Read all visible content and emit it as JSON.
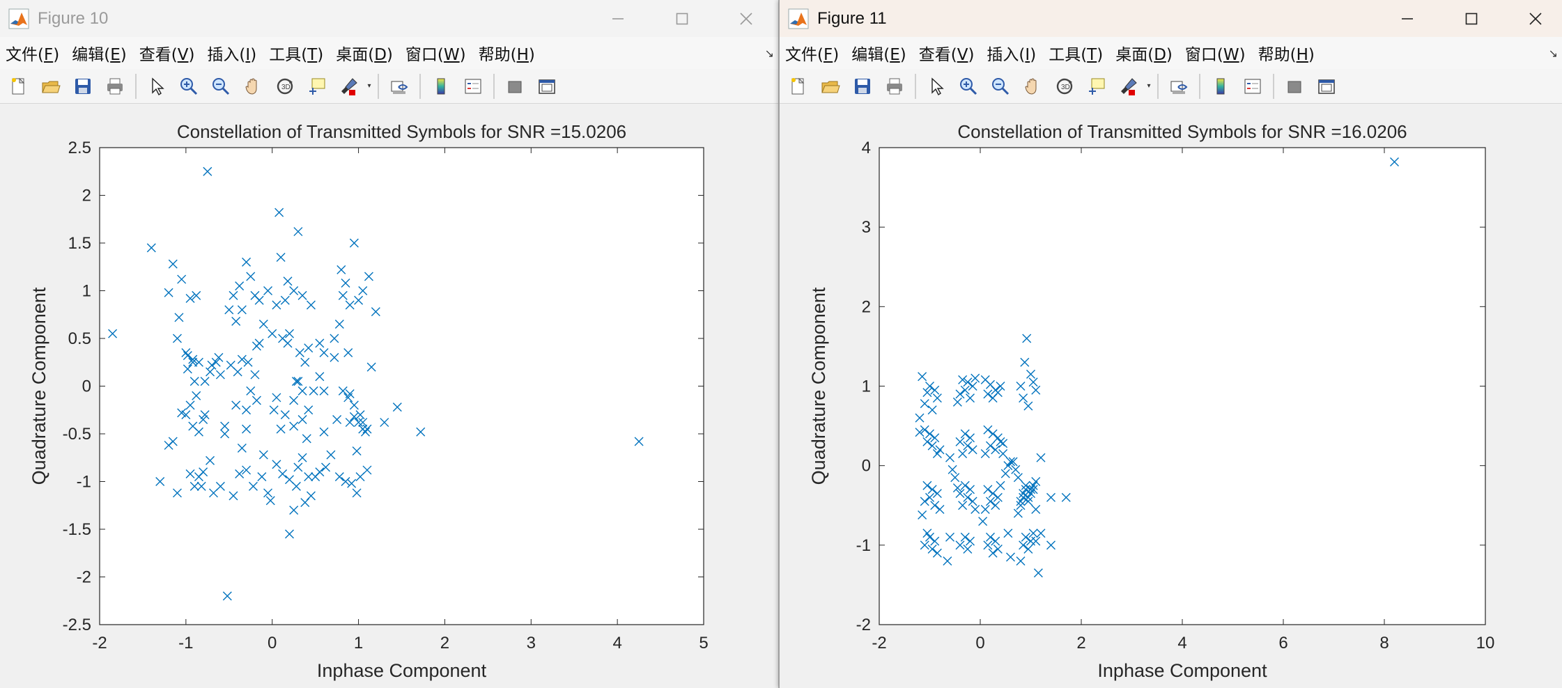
{
  "menu": [
    {
      "label": "文件(",
      "key": "F",
      "tail": ")"
    },
    {
      "label": "编辑(",
      "key": "E",
      "tail": ")"
    },
    {
      "label": "查看(",
      "key": "V",
      "tail": ")"
    },
    {
      "label": "插入(",
      "key": "I",
      "tail": ")"
    },
    {
      "label": "工具(",
      "key": "T",
      "tail": ")"
    },
    {
      "label": "桌面(",
      "key": "D",
      "tail": ")"
    },
    {
      "label": "窗口(",
      "key": "W",
      "tail": ")"
    },
    {
      "label": "帮助(",
      "key": "H",
      "tail": ")"
    }
  ],
  "toolbar_icons": [
    "new-figure-icon",
    "open-file-icon",
    "save-icon",
    "print-icon",
    "|",
    "pointer-icon",
    "zoom-in-icon",
    "zoom-out-icon",
    "pan-hand-icon",
    "rotate-3d-icon",
    "data-cursor-icon",
    "brush-icon",
    "v",
    "|",
    "link-plot-icon",
    "|",
    "colorbar-icon",
    "legend-icon",
    "|",
    "hide-plot-tools-icon",
    "show-plot-tools-icon"
  ],
  "colors": {
    "marker": "#0072BD",
    "axes_text": "#262626",
    "matlab_orange": "#e8731c"
  },
  "windows": [
    {
      "title": "Figure 10",
      "chart_data": {
        "type": "scatter",
        "marker": "x",
        "title": "Constellation of Transmitted Symbols for SNR =15.0206",
        "xlabel": "Inphase Component",
        "ylabel": "Quadrature Component",
        "xlim": [
          -2,
          5
        ],
        "ylim": [
          -2.5,
          2.5
        ],
        "xticks": [
          -2,
          -1,
          0,
          1,
          2,
          3,
          4,
          5
        ],
        "yticks": [
          -2.5,
          -2,
          -1.5,
          -1,
          -0.5,
          0,
          0.5,
          1,
          1.5,
          2,
          2.5
        ],
        "xtick_labels": [
          "-2",
          "-1",
          "0",
          "1",
          "2",
          "3",
          "4",
          "5"
        ],
        "ytick_labels": [
          "-2.5",
          "-2",
          "-1.5",
          "-1",
          "-0.5",
          "0",
          "0.5",
          "1",
          "1.5",
          "2",
          "2.5"
        ],
        "x": [
          -1.85,
          -1.4,
          -0.75,
          0.08,
          0.3,
          -1.2,
          -1.15,
          -1.05,
          -0.95,
          -0.88,
          -1.08,
          -0.3,
          -0.25,
          -0.45,
          -0.38,
          -0.5,
          0.1,
          0.18,
          0.25,
          0.35,
          0.45,
          0.15,
          0.05,
          -0.15,
          -0.05,
          -0.2,
          -0.35,
          -0.42,
          0.8,
          0.85,
          0.95,
          1.0,
          1.05,
          1.12,
          0.9,
          0.82,
          0.78,
          1.2,
          0.72,
          0.2,
          0.32,
          0.42,
          0.55,
          0.38,
          -1.1,
          -1.0,
          -0.92,
          -0.85,
          -0.98,
          -0.7,
          -0.78,
          -0.65,
          -0.88,
          -0.95,
          -1.05,
          -0.15,
          -0.4,
          -0.28,
          0.28,
          0.48,
          0.25,
          0.6,
          0.35,
          0.15,
          -0.55,
          0.82,
          0.88,
          0.95,
          1.02,
          0.75,
          1.05,
          1.1,
          1.3,
          1.45,
          1.72,
          4.25,
          -1.3,
          -1.1,
          -0.9,
          -0.95,
          -0.82,
          -0.72,
          -0.68,
          -0.85,
          -0.6,
          -0.45,
          -0.38,
          -0.3,
          -0.22,
          -0.12,
          -0.05,
          0.05,
          0.12,
          0.2,
          0.28,
          0.35,
          0.42,
          0.55,
          0.62,
          0.78,
          0.85,
          0.92,
          0.98,
          1.02,
          1.1,
          -1.15,
          -0.92,
          -0.8,
          -0.55,
          -0.3,
          -0.18,
          0.02,
          0.1,
          0.25,
          0.4,
          0.6,
          0.9,
          0.95,
          1.05,
          0.2,
          0.25,
          -0.52,
          0.38,
          0.45,
          -0.02,
          -0.1,
          -0.35,
          -0.85,
          -1.0,
          -0.78,
          0.3,
          0.68,
          0.5,
          0.88,
          1.15,
          -0.62,
          -0.2,
          0.0,
          -0.9,
          0.05,
          0.35,
          -0.72,
          -0.3,
          1.0,
          -0.48,
          -0.98,
          -0.35,
          0.6,
          -0.25,
          -0.1,
          0.72,
          0.9,
          -1.2,
          0.12,
          -0.6,
          0.42,
          -0.92,
          0.18,
          0.55,
          1.08,
          -0.42,
          -0.18,
          0.3,
          0.98,
          -0.8,
          -1.05
        ],
        "y": [
          0.55,
          1.45,
          2.25,
          1.82,
          1.62,
          0.98,
          1.28,
          1.12,
          0.92,
          0.95,
          0.72,
          1.3,
          1.15,
          0.95,
          1.05,
          0.8,
          1.35,
          1.1,
          1.0,
          0.95,
          0.85,
          0.9,
          0.85,
          0.9,
          1.0,
          0.95,
          0.8,
          0.68,
          1.22,
          1.08,
          1.5,
          0.9,
          1.0,
          1.15,
          0.85,
          0.95,
          0.65,
          0.78,
          0.5,
          0.55,
          0.35,
          0.4,
          0.45,
          0.25,
          0.5,
          0.35,
          0.28,
          0.25,
          0.18,
          0.22,
          0.05,
          0.25,
          -0.1,
          -0.2,
          -0.28,
          0.45,
          0.15,
          0.25,
          0.05,
          -0.05,
          -0.15,
          -0.05,
          -0.35,
          -0.3,
          -0.42,
          -0.05,
          -0.12,
          -0.2,
          -0.3,
          -0.35,
          -0.38,
          -0.45,
          -0.38,
          -0.22,
          -0.48,
          -0.58,
          -1.0,
          -1.12,
          -1.05,
          -0.92,
          -1.05,
          -0.78,
          -1.12,
          -0.95,
          -1.05,
          -1.15,
          -0.92,
          -0.88,
          -1.05,
          -0.95,
          -1.12,
          -0.82,
          -0.92,
          -0.98,
          -1.05,
          -0.75,
          -0.95,
          -0.9,
          -0.85,
          -0.95,
          -1.0,
          -1.02,
          -1.12,
          -0.95,
          -0.88,
          -0.58,
          -0.42,
          -0.35,
          -0.5,
          -0.45,
          -0.15,
          -0.25,
          -0.45,
          -0.42,
          -0.55,
          -0.48,
          -0.38,
          -0.32,
          -0.45,
          -1.55,
          -1.3,
          -2.2,
          -1.22,
          -1.15,
          -1.2,
          -0.72,
          -0.65,
          -0.48,
          -0.3,
          -0.3,
          -0.85,
          -0.72,
          -0.95,
          0.35,
          0.2,
          0.3,
          0.12,
          0.55,
          0.05,
          -0.12,
          -0.05,
          0.15,
          -0.25,
          -0.38,
          0.22,
          0.32,
          0.28,
          0.35,
          -0.05,
          0.65,
          0.3,
          -0.08,
          -0.62,
          0.5,
          0.12,
          -0.25,
          0.25,
          0.45,
          0.1,
          -0.48,
          -0.2,
          0.42,
          0.05,
          -0.68,
          -0.9
        ]
      }
    },
    {
      "title": "Figure 11",
      "chart_data": {
        "type": "scatter",
        "marker": "x",
        "title": "Constellation of Transmitted Symbols for SNR =16.0206",
        "xlabel": "Inphase Component",
        "ylabel": "Quadrature Component",
        "xlim": [
          -2,
          10
        ],
        "ylim": [
          -2,
          4
        ],
        "xticks": [
          -2,
          0,
          2,
          4,
          6,
          8,
          10
        ],
        "yticks": [
          -2,
          -1,
          0,
          1,
          2,
          3,
          4
        ],
        "xtick_labels": [
          "-2",
          "0",
          "2",
          "4",
          "6",
          "8",
          "10"
        ],
        "ytick_labels": [
          "-2",
          "-1",
          "0",
          "1",
          "2",
          "3",
          "4"
        ],
        "x": [
          8.2,
          0.92,
          0.88,
          1.0,
          1.05,
          0.8,
          1.1,
          0.85,
          0.95,
          -1.15,
          -1.0,
          -0.9,
          -1.05,
          -0.85,
          -1.1,
          -0.95,
          -1.2,
          -0.35,
          -0.25,
          -0.15,
          -0.3,
          -0.4,
          -0.2,
          -0.1,
          -0.45,
          0.1,
          0.2,
          0.3,
          0.35,
          0.15,
          0.25,
          0.4,
          -1.1,
          -1.0,
          -0.9,
          -1.05,
          -0.95,
          -0.8,
          -1.2,
          -0.85,
          -0.3,
          -0.2,
          -0.4,
          -0.25,
          -0.15,
          -0.35,
          0.15,
          0.25,
          0.35,
          0.4,
          0.2,
          0.3,
          0.1,
          0.45,
          0.9,
          1.0,
          0.85,
          0.95,
          0.8,
          1.05,
          1.1,
          0.75,
          1.4,
          1.2,
          1.7,
          -1.05,
          -0.95,
          -0.85,
          -1.0,
          -1.1,
          -0.9,
          -0.8,
          -1.15,
          -0.3,
          -0.2,
          -0.4,
          -0.25,
          -0.15,
          -0.35,
          -0.1,
          -0.45,
          0.15,
          0.25,
          0.35,
          0.2,
          0.3,
          0.1,
          0.4,
          0.9,
          1.0,
          0.85,
          0.95,
          0.8,
          1.1,
          1.05,
          0.75,
          1.4,
          1.2,
          1.15,
          -1.0,
          -0.9,
          -1.1,
          -0.95,
          -0.85,
          -1.05,
          -0.3,
          -0.2,
          -0.4,
          -0.25,
          0.2,
          0.3,
          0.15,
          0.35,
          0.25,
          0.9,
          1.0,
          0.85,
          0.95,
          1.05,
          1.1,
          0.8,
          0.05,
          0.6,
          0.55,
          0.5,
          -0.55,
          -0.6,
          0.65,
          0.7,
          -0.5,
          0.45,
          -0.6,
          0.55,
          -0.65,
          0.6
        ],
        "y": [
          3.82,
          1.6,
          1.3,
          1.15,
          1.05,
          1.0,
          0.95,
          0.85,
          0.75,
          1.12,
          1.0,
          0.95,
          0.92,
          0.85,
          0.78,
          0.7,
          0.6,
          1.08,
          1.05,
          1.0,
          0.95,
          0.9,
          0.85,
          1.1,
          0.8,
          1.08,
          1.02,
          0.95,
          0.92,
          0.9,
          0.85,
          1.0,
          0.45,
          0.4,
          0.35,
          0.3,
          0.25,
          0.2,
          0.42,
          0.15,
          0.4,
          0.35,
          0.3,
          0.25,
          0.2,
          0.15,
          0.45,
          0.4,
          0.35,
          0.3,
          0.25,
          0.2,
          0.15,
          0.28,
          -0.25,
          -0.3,
          -0.35,
          -0.4,
          -0.45,
          -0.3,
          -0.2,
          -0.15,
          -0.4,
          0.1,
          -0.4,
          -0.25,
          -0.3,
          -0.35,
          -0.4,
          -0.45,
          -0.5,
          -0.55,
          -0.62,
          -0.25,
          -0.3,
          -0.35,
          -0.4,
          -0.45,
          -0.5,
          -0.55,
          -0.28,
          -0.3,
          -0.35,
          -0.4,
          -0.45,
          -0.5,
          -0.55,
          -0.25,
          -0.3,
          -0.35,
          -0.4,
          -0.45,
          -0.5,
          -0.55,
          -0.25,
          -0.6,
          -1.0,
          -0.85,
          -1.35,
          -0.9,
          -0.95,
          -1.0,
          -1.05,
          -1.1,
          -0.85,
          -0.9,
          -0.95,
          -1.0,
          -1.05,
          -0.9,
          -0.95,
          -1.0,
          -1.05,
          -1.1,
          -0.9,
          -0.95,
          -1.0,
          -1.05,
          -0.85,
          -0.95,
          -1.2,
          -0.7,
          0.05,
          0.0,
          -0.1,
          -0.05,
          0.1,
          0.05,
          -0.05,
          -0.15,
          0.15,
          -0.9,
          -0.85,
          -1.2,
          -1.15
        ]
      }
    }
  ]
}
